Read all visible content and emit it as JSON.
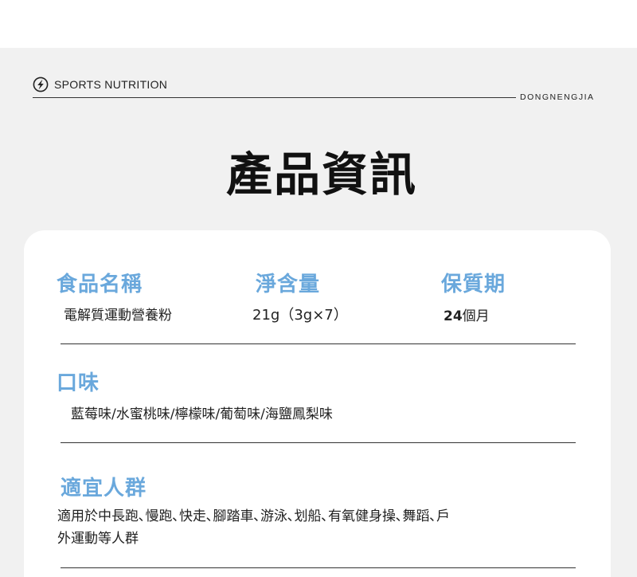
{
  "header": {
    "brand_left": "SPORTS NUTRITION",
    "brand_right": "DONGNENGJIA",
    "title": "產品資訊"
  },
  "info": {
    "name_label": "食品名稱",
    "name_value": "電解質運動營養粉",
    "net_label": "淨含量",
    "net_value": "21g（3g×7）",
    "shelf_label": "保質期",
    "shelf_number": "24",
    "shelf_unit": "個月",
    "flavor_label": "口味",
    "flavor_value": "藍莓味/水蜜桃味/檸檬味/葡萄味/海鹽鳳梨味",
    "audience_label": "適宜人群",
    "audience_line1": "適用於中長跑､慢跑､快走､腳踏車､游泳､划船､有氧健身操､舞蹈､戶",
    "audience_line2": "外運動等人群"
  },
  "icons": {
    "brand": "lightning-bolt-icon"
  },
  "colors": {
    "label_blue": "#6aa8dc",
    "background_grey": "#f1f1f1",
    "card": "#ffffff"
  }
}
